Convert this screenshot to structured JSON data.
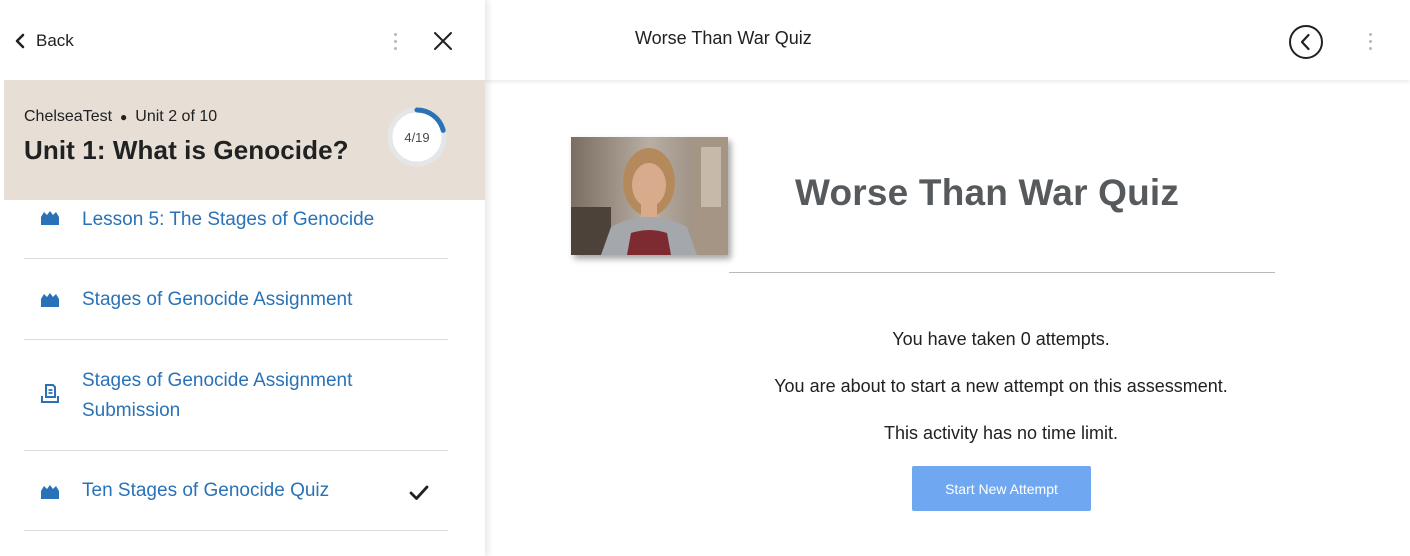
{
  "sidebar": {
    "back_label": "Back",
    "unit": {
      "course": "ChelseaTest",
      "position": "Unit 2 of 10",
      "title": "Unit 1: What is Genocide?",
      "progress_label": "4/19",
      "progress_fraction": 0.21
    },
    "items": [
      {
        "label": "Lesson 5: The Stages of Genocide",
        "icon": "lesson-blocks-icon",
        "completed": false
      },
      {
        "label": "Stages of Genocide Assignment",
        "icon": "lesson-blocks-icon",
        "completed": false
      },
      {
        "label": "Stages of Genocide Assignment Submission",
        "icon": "assignment-submission-icon",
        "completed": false
      },
      {
        "label": "Ten Stages of Genocide Quiz",
        "icon": "lesson-blocks-icon",
        "completed": true
      }
    ]
  },
  "topbar": {
    "title": "Worse Than War Quiz"
  },
  "main": {
    "quiz_title": "Worse Than War Quiz",
    "attempts_text": "You have taken 0 attempts.",
    "new_attempt_text": "You are about to start a new attempt on this assessment.",
    "time_limit_text": "This activity has no time limit.",
    "start_button_label": "Start New Attempt"
  },
  "colors": {
    "link": "#2a72b8",
    "unit_header_bg": "#e7ded5",
    "progress_ring": "#2a72b8",
    "button_bg": "#6fa8f0"
  }
}
